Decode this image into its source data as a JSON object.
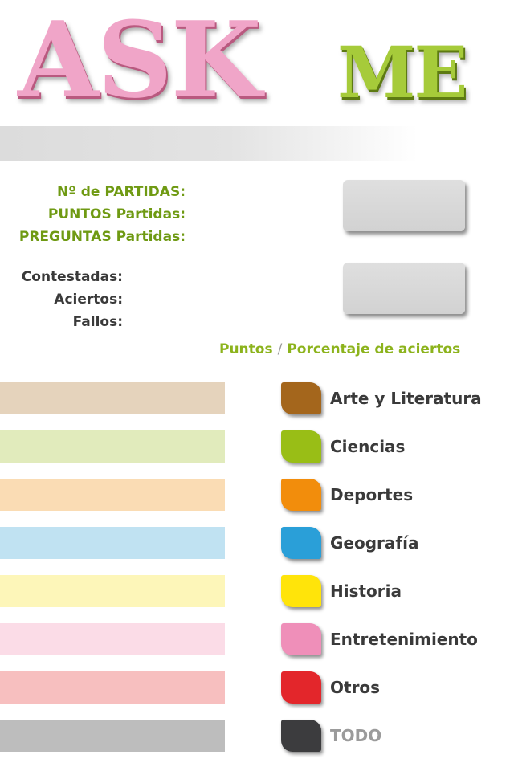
{
  "logo": {
    "ask": "ASK",
    "me": "ME",
    "ask_color": "#f0a5c8",
    "me_color": "#a6cb3a"
  },
  "stats": {
    "partidas_label": "Nº de PARTIDAS:",
    "puntos_label": "PUNTOS Partidas:",
    "preguntas_label": "PREGUNTAS Partidas:",
    "contestadas_label": "Contestadas:",
    "aciertos_label": "Aciertos:",
    "fallos_label": "Fallos:"
  },
  "legend": {
    "puntos": "Puntos",
    "separator": "/",
    "porcentaje": "Porcentaje de aciertos"
  },
  "categories": [
    {
      "label": "Arte y Literatura",
      "color": "#a4661c",
      "bar_color": "#e5d3bc"
    },
    {
      "label": "Ciencias",
      "color": "#99be16",
      "bar_color": "#e1ebbc"
    },
    {
      "label": "Deportes",
      "color": "#f28d0c",
      "bar_color": "#fadcb4"
    },
    {
      "label": "Geografía",
      "color": "#2a9fd8",
      "bar_color": "#c0e2f2"
    },
    {
      "label": "Historia",
      "color": "#ffe40a",
      "bar_color": "#fdf6b9"
    },
    {
      "label": "Entretenimiento",
      "color": "#ef8fb9",
      "bar_color": "#fbdce7"
    },
    {
      "label": "Otros",
      "color": "#e3262b",
      "bar_color": "#f7bfbf"
    },
    {
      "label": "TODO",
      "color": "#3c3c3e",
      "bar_color": "#bdbdbd"
    }
  ]
}
